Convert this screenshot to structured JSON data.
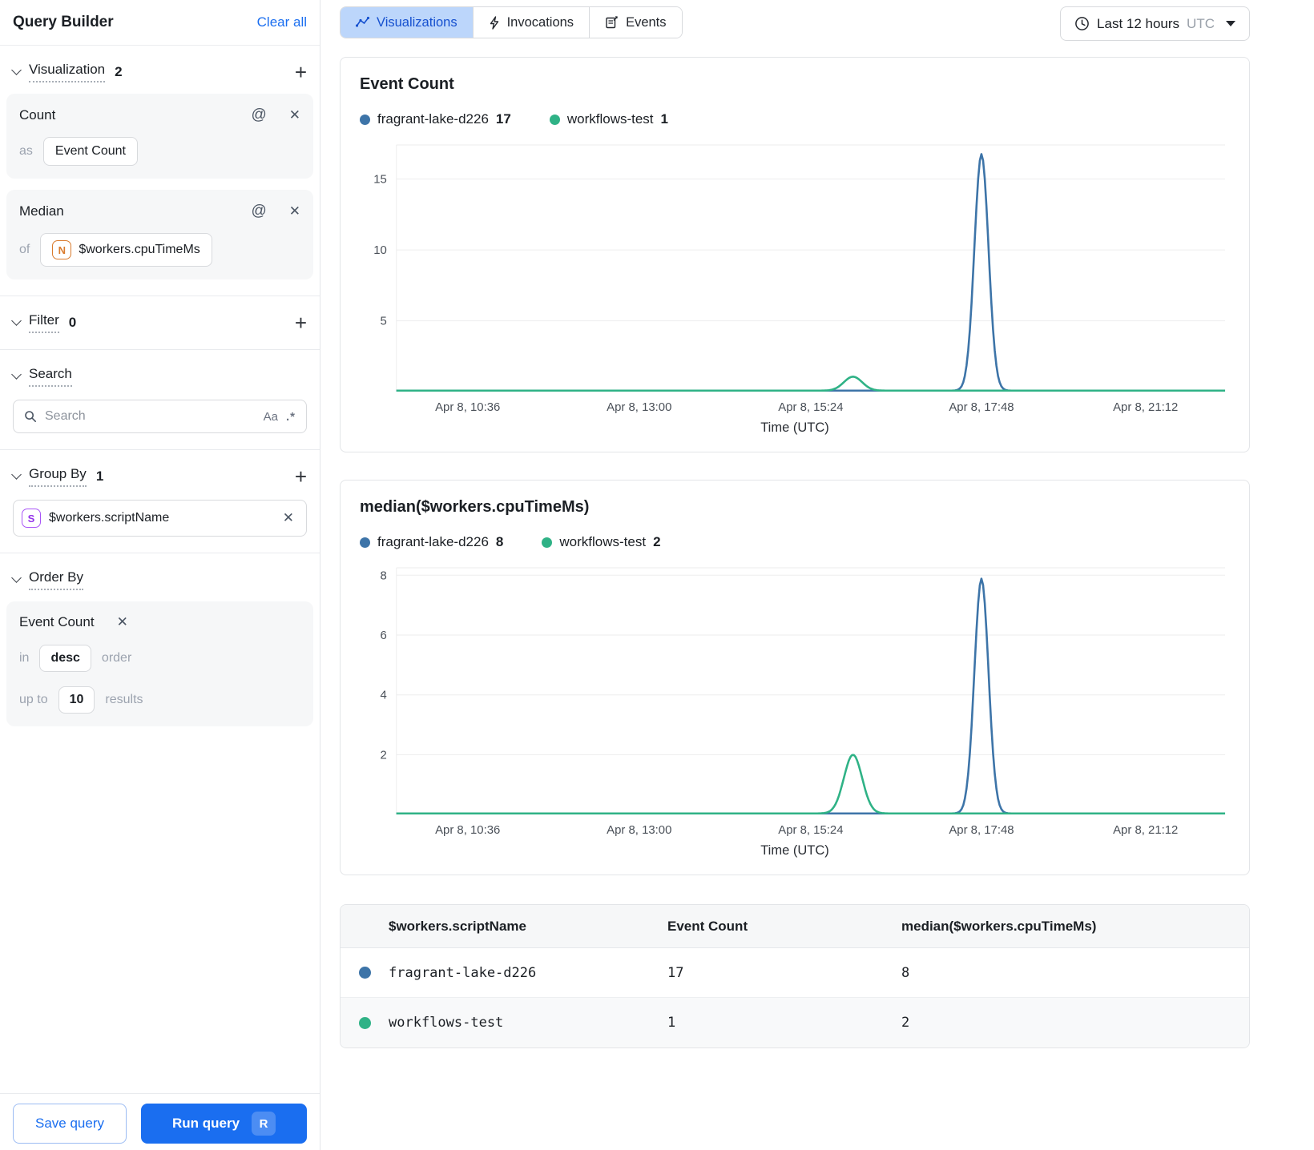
{
  "sidebar": {
    "title": "Query Builder",
    "clear_all": "Clear all",
    "visualization": {
      "label": "Visualization",
      "count": "2",
      "cards": [
        {
          "title": "Count",
          "prefix": "as",
          "value": "Event Count"
        },
        {
          "title": "Median",
          "prefix": "of",
          "value": "$workers.cpuTimeMs",
          "badge": "N"
        }
      ]
    },
    "filter": {
      "label": "Filter",
      "count": "0"
    },
    "search": {
      "label": "Search",
      "placeholder": "Search",
      "case_toggle": "Aa",
      "regex_toggle": ".*"
    },
    "group_by": {
      "label": "Group By",
      "count": "1",
      "field": {
        "badge": "S",
        "value": "$workers.scriptName"
      }
    },
    "order_by": {
      "label": "Order By",
      "card": {
        "title": "Event Count",
        "in_label": "in",
        "order_value": "desc",
        "order_label": "order",
        "upto_label": "up to",
        "limit_value": "10",
        "results_label": "results"
      }
    },
    "footer": {
      "save": "Save query",
      "run": "Run query",
      "run_shortcut": "R"
    }
  },
  "topbar": {
    "tabs": [
      {
        "label": "Visualizations",
        "icon": "chart-line-icon",
        "active": true
      },
      {
        "label": "Invocations",
        "icon": "lightning-icon",
        "active": false
      },
      {
        "label": "Events",
        "icon": "event-note-icon",
        "active": false
      }
    ],
    "time_range": {
      "label": "Last 12 hours",
      "zone": "UTC"
    }
  },
  "colors": {
    "series_blue": "#3d74a8",
    "series_green": "#2fb286",
    "accent_blue": "#1a6ef0",
    "tab_active_bg": "#bcd6fb",
    "tab_active_fg": "#1550cf"
  },
  "chart_data": [
    {
      "type": "line",
      "title": "Event Count",
      "xlabel": "Time (UTC)",
      "x_ticks": [
        {
          "label": "Apr 8, 10:36",
          "pos": 0.086
        },
        {
          "label": "Apr 8, 13:00",
          "pos": 0.293
        },
        {
          "label": "Apr 8, 15:24",
          "pos": 0.5
        },
        {
          "label": "Apr 8, 17:48",
          "pos": 0.706
        },
        {
          "label": "Apr 8, 21:12",
          "pos": 0.904
        }
      ],
      "y_ticks": [
        5,
        10,
        15
      ],
      "ylim": [
        0,
        17.4
      ],
      "grid": true,
      "legend_position": "top",
      "legend": [
        {
          "name": "fragrant-lake-d226",
          "value": "17",
          "color": "blue"
        },
        {
          "name": "workflows-test",
          "value": "1",
          "color": "green"
        }
      ],
      "series": [
        {
          "name": "fragrant-lake-d226",
          "color": "blue",
          "baseline": 0,
          "spikes": [
            {
              "x": 0.706,
              "peak": 17,
              "width": 0.0085
            }
          ]
        },
        {
          "name": "workflows-test",
          "color": "green",
          "baseline": 0,
          "spikes": [
            {
              "x": 0.551,
              "peak": 1,
              "width": 0.011
            }
          ]
        }
      ]
    },
    {
      "type": "line",
      "title": "median($workers.cpuTimeMs)",
      "xlabel": "Time (UTC)",
      "x_ticks": [
        {
          "label": "Apr 8, 10:36",
          "pos": 0.086
        },
        {
          "label": "Apr 8, 13:00",
          "pos": 0.293
        },
        {
          "label": "Apr 8, 15:24",
          "pos": 0.5
        },
        {
          "label": "Apr 8, 17:48",
          "pos": 0.706
        },
        {
          "label": "Apr 8, 21:12",
          "pos": 0.904
        }
      ],
      "y_ticks": [
        2,
        4,
        6,
        8
      ],
      "ylim": [
        0,
        8.25
      ],
      "grid": true,
      "legend_position": "top",
      "legend": [
        {
          "name": "fragrant-lake-d226",
          "value": "8",
          "color": "blue"
        },
        {
          "name": "workflows-test",
          "value": "2",
          "color": "green"
        }
      ],
      "series": [
        {
          "name": "fragrant-lake-d226",
          "color": "blue",
          "baseline": 0,
          "spikes": [
            {
              "x": 0.706,
              "peak": 8,
              "width": 0.0085
            }
          ]
        },
        {
          "name": "workflows-test",
          "color": "green",
          "baseline": 0,
          "spikes": [
            {
              "x": 0.551,
              "peak": 2,
              "width": 0.011
            }
          ]
        }
      ]
    }
  ],
  "table": {
    "columns": [
      "$workers.scriptName",
      "Event Count",
      "median($workers.cpuTimeMs)"
    ],
    "rows": [
      {
        "name": "fragrant-lake-d226",
        "event_count": "17",
        "median": "8",
        "color": "blue"
      },
      {
        "name": "workflows-test",
        "event_count": "1",
        "median": "2",
        "color": "green"
      }
    ]
  }
}
